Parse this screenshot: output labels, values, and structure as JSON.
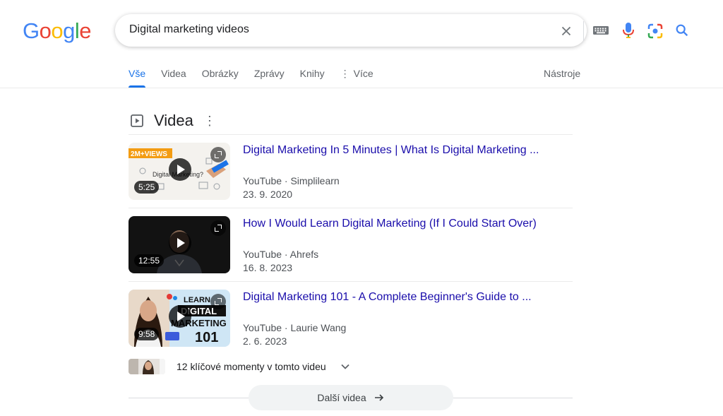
{
  "logo": {
    "letters": [
      "G",
      "o",
      "o",
      "g",
      "l",
      "e"
    ],
    "colors": [
      "#4285F4",
      "#EA4335",
      "#FBBC05",
      "#4285F4",
      "#34A853",
      "#EA4335"
    ]
  },
  "search": {
    "query": "Digital marketing videos"
  },
  "tabs": [
    {
      "label": "Vše",
      "active": true
    },
    {
      "label": "Videa"
    },
    {
      "label": "Obrázky"
    },
    {
      "label": "Zprávy"
    },
    {
      "label": "Knihy"
    },
    {
      "label": "Více"
    }
  ],
  "tools_label": "Nástroje",
  "section": {
    "title": "Videa"
  },
  "videos": [
    {
      "title": "Digital Marketing In 5 Minutes | What Is Digital Marketing ...",
      "source": "YouTube · Simplilearn",
      "date": "23. 9. 2020",
      "duration": "5:25",
      "thumb_badge": "2M+VIEWS"
    },
    {
      "title": "How I Would Learn Digital Marketing (If I Could Start Over)",
      "source": "YouTube · Ahrefs",
      "date": "16. 8. 2023",
      "duration": "12:55"
    },
    {
      "title": "Digital Marketing 101 - A Complete Beginner's Guide to ...",
      "source": "YouTube · Laurie Wang",
      "date": "2. 6. 2023",
      "duration": "9:58",
      "thumb_text": [
        "LEARN",
        "DIGITAL",
        "MARKETING",
        "101"
      ]
    }
  ],
  "key_moments": "12 klíčové momenty v tomto videu",
  "more_videos": "Další videa",
  "colors": {
    "link": "#1a0dab",
    "accent": "#1a73e8"
  }
}
